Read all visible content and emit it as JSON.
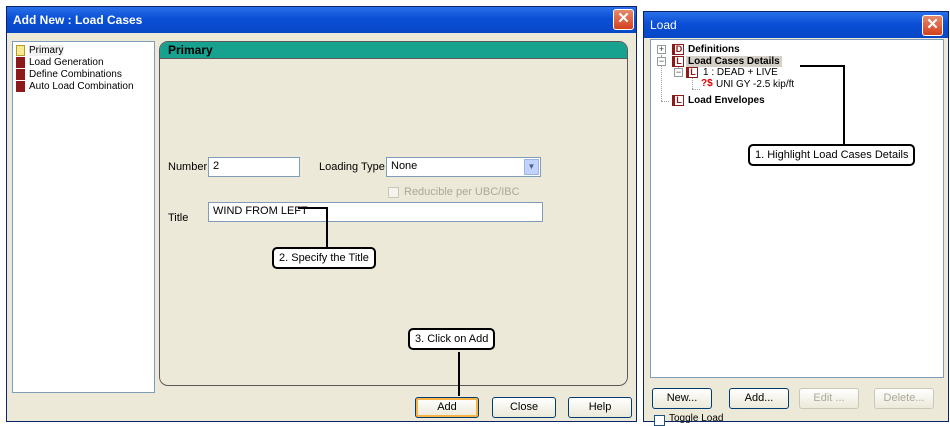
{
  "dialog": {
    "title": "Add New : Load Cases",
    "close": "✕",
    "nav": [
      "Primary",
      "Load Generation",
      "Define Combinations",
      "Auto Load Combination"
    ],
    "panel_title": "Primary",
    "number_label": "Number",
    "number_value": "2",
    "loading_type_label": "Loading Type :",
    "loading_type_value": "None",
    "reducible_label": "Reducible per UBC/IBC",
    "title_label": "Title",
    "title_value": "WIND FROM LEFT",
    "buttons": {
      "add": "Add",
      "close": "Close",
      "help": "Help"
    }
  },
  "load_window": {
    "title": "Load",
    "close": "✕",
    "tree": {
      "definitions": "Definitions",
      "load_cases_details": "Load Cases Details",
      "case_1": "1 : DEAD + LIVE",
      "uni": "UNI GY -2.5 kip/ft",
      "load_envelopes": "Load Envelopes"
    },
    "buttons": {
      "new": "New...",
      "add": "Add...",
      "edit": "Edit ...",
      "delete": "Delete..."
    },
    "toggle_label": "Toggle Load"
  },
  "callouts": {
    "step1": "1. Highlight Load Cases Details",
    "step2": "2. Specify the Title",
    "step3": "3. Click on Add"
  },
  "icons": {
    "definitions_icon": "D",
    "load_icon": "L",
    "uni_icon": "?$"
  },
  "colors": {
    "titlebar": "#0a4fd6",
    "panel_header": "#16a28e",
    "close_button": "#d3411e"
  }
}
